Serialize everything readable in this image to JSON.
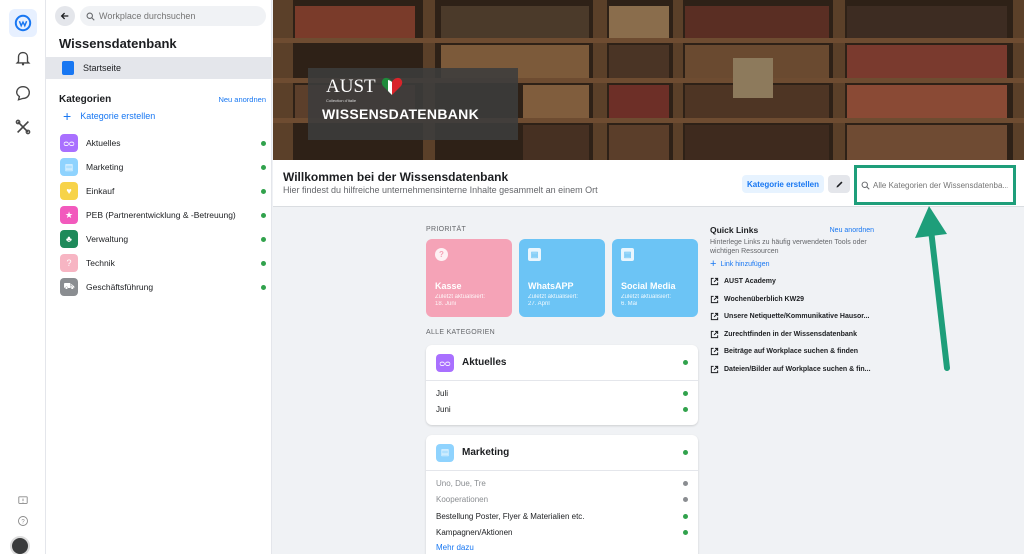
{
  "rail": {
    "icons": [
      "workplace-logo-icon",
      "bell-icon",
      "chat-icon",
      "tools-icon",
      "feedback-icon",
      "help-icon"
    ]
  },
  "sidebar": {
    "search_placeholder": "Workplace durchsuchen",
    "title": "Wissensdatenbank",
    "start_item": "Startseite",
    "categories_heading": "Kategorien",
    "reorder_label": "Neu anordnen",
    "create_category": "Kategorie erstellen",
    "categories": [
      {
        "label": "Aktuelles",
        "color": "#a970ff",
        "icon": "glasses-icon"
      },
      {
        "label": "Marketing",
        "color": "#8fd3fe",
        "icon": "document-icon"
      },
      {
        "label": "Einkauf",
        "color": "#f7d349",
        "icon": "heart-icon"
      },
      {
        "label": "PEB (Partnerentwicklung & -Betreuung)",
        "color": "#f25abd",
        "icon": "star-icon"
      },
      {
        "label": "Verwaltung",
        "color": "#1e8a5a",
        "icon": "tree-icon"
      },
      {
        "label": "Technik",
        "color": "#f7b5c3",
        "icon": "question-icon"
      },
      {
        "label": "Geschäftsführung",
        "color": "#8a8d91",
        "icon": "cart-icon"
      }
    ]
  },
  "hero": {
    "logo_brand": "AUST",
    "logo_tagline": "Collection d'Italie",
    "logo_title": "WISSENSDATENBANK"
  },
  "welcome": {
    "heading": "Willkommen bei der Wissensdatenbank",
    "subheading": "Hier findest du hilfreiche unternehmensinterne Inhalte gesammelt an einem Ort",
    "create_button": "Kategorie erstellen",
    "search_placeholder": "Alle Kategorien der Wissensdatenba..."
  },
  "priority": {
    "label": "PRIORITÄT",
    "cards": [
      {
        "title": "Kasse",
        "updated": "Zuletzt aktualisiert:",
        "date": "18. Juni",
        "color": "#f5a3b7",
        "icon": "?"
      },
      {
        "title": "WhatsAPP",
        "updated": "Zuletzt aktualisiert:",
        "date": "27. April",
        "color": "#6cc4f5",
        "icon": "▤"
      },
      {
        "title": "Social Media",
        "updated": "Zuletzt aktualisiert:",
        "date": "6. Mai",
        "color": "#6cc4f5",
        "icon": "▤"
      }
    ]
  },
  "all_categories": {
    "label": "ALLE KATEGORIEN",
    "aktuelles": {
      "title": "Aktuelles",
      "rows": [
        "Juli",
        "Juni"
      ]
    },
    "marketing": {
      "title": "Marketing",
      "rows": [
        {
          "label": "Uno, Due, Tre",
          "muted": true
        },
        {
          "label": "Kooperationen",
          "muted": true
        },
        {
          "label": "Bestellung Poster, Flyer & Materialien etc.",
          "muted": false
        },
        {
          "label": "Kampagnen/Aktionen",
          "muted": false
        }
      ],
      "more": "Mehr dazu"
    }
  },
  "quick_links": {
    "title": "Quick Links",
    "reorder_label": "Neu anordnen",
    "description": "Hinterlege Links zu häufig verwendeten Tools oder wichtigen Ressourcen",
    "add_link": "Link hinzufügen",
    "links": [
      "AUST Academy",
      "Wochenüberblich KW29",
      "Unsere Netiquette/Kommunikative Hausor...",
      "Zurechtfinden in der Wissensdatenbank",
      "Beiträge auf Workplace suchen & finden",
      "Dateien/Bilder auf Workplace suchen & fin..."
    ]
  },
  "colors": {
    "accent": "#1877f2",
    "highlight": "#1e9e7a",
    "status_green": "#31a24c"
  }
}
